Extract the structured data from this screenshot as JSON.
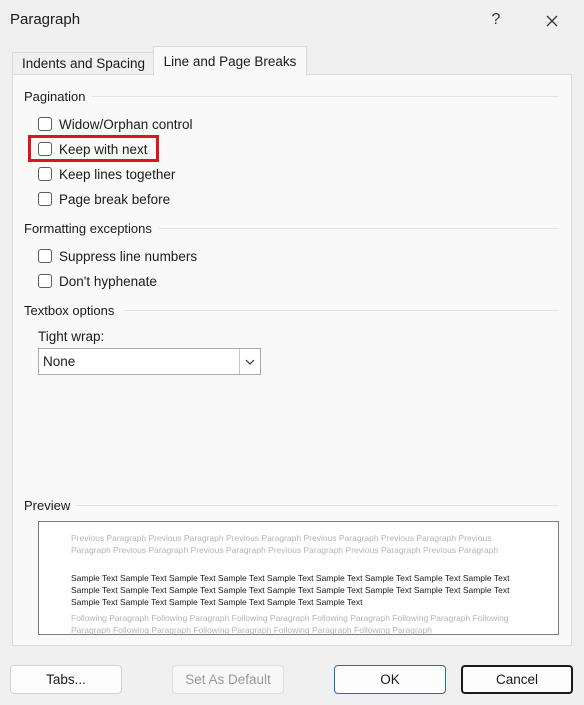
{
  "window": {
    "title": "Paragraph",
    "help": "?"
  },
  "tabs": [
    {
      "label": "Indents and Spacing"
    },
    {
      "label": "Line and Page Breaks"
    }
  ],
  "pagination": {
    "heading": "Pagination",
    "options": [
      {
        "label": "Widow/Orphan control",
        "checked": false
      },
      {
        "label": "Keep with next",
        "checked": false
      },
      {
        "label": "Keep lines together",
        "checked": false
      },
      {
        "label": "Page break before",
        "checked": false
      }
    ]
  },
  "formatting": {
    "heading": "Formatting exceptions",
    "options": [
      {
        "label": "Suppress line numbers",
        "checked": false
      },
      {
        "label": "Don't hyphenate",
        "checked": false
      }
    ]
  },
  "textbox": {
    "heading": "Textbox options",
    "tight_wrap_label": "Tight wrap:",
    "tight_wrap_value": "None"
  },
  "preview": {
    "heading": "Preview",
    "previous_text": "Previous Paragraph Previous Paragraph Previous Paragraph Previous Paragraph Previous Paragraph Previous Paragraph Previous Paragraph Previous Paragraph Previous Paragraph Previous Paragraph Previous Paragraph",
    "sample_text": "Sample Text Sample Text Sample Text Sample Text Sample Text Sample Text Sample Text Sample Text Sample Text Sample Text Sample Text Sample Text Sample Text Sample Text Sample Text Sample Text Sample Text Sample Text Sample Text Sample Text Sample Text Sample Text Sample Text Sample Text",
    "following_text": "Following Paragraph Following Paragraph Following Paragraph Following Paragraph Following Paragraph Following Paragraph Following Paragraph Following Paragraph Following Paragraph Following Paragraph"
  },
  "buttons": {
    "tabs": "Tabs...",
    "set_default": "Set As Default",
    "ok": "OK",
    "cancel": "Cancel"
  },
  "colors": {
    "highlight": "#e0141e",
    "focus": "#1f6fbf"
  }
}
